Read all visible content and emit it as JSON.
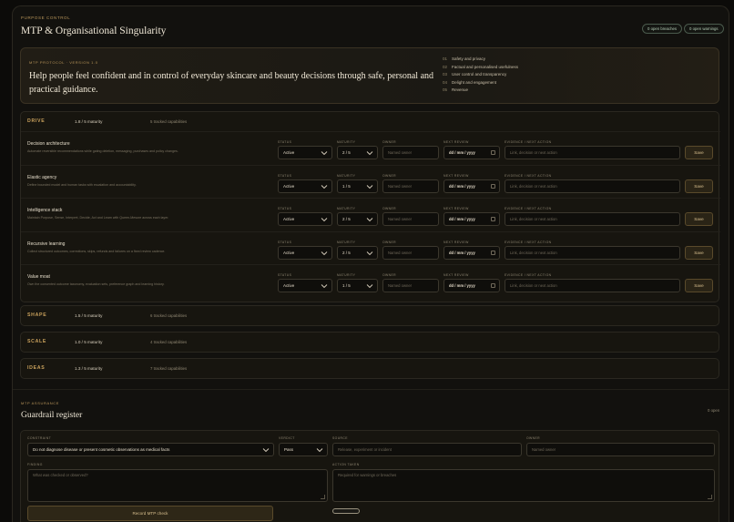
{
  "header": {
    "eyebrow": "PURPOSE CONTROL",
    "title": "MTP & Organisational Singularity",
    "breaches": "0 open breaches",
    "warnings": "0 open warnings"
  },
  "protocol": {
    "label": "MTP PROTOCOL · VERSION 1.0",
    "statement": "Help people feel confident and in control of everyday skincare and beauty decisions through safe, personal and practical guidance.",
    "principles": [
      {
        "n": "01",
        "label": "Safety and privacy"
      },
      {
        "n": "02",
        "label": "Factual and personalised usefulness"
      },
      {
        "n": "03",
        "label": "User control and transparency"
      },
      {
        "n": "04",
        "label": "Delight and engagement"
      },
      {
        "n": "05",
        "label": "Revenue"
      }
    ]
  },
  "labels": {
    "status": "STATUS",
    "maturity": "MATURITY",
    "owner": "OWNER",
    "next_review": "NEXT REVIEW",
    "evidence": "EVIDENCE / NEXT ACTION",
    "owner_ph": "Named owner",
    "date_ph": "dd / mm / yyyy",
    "evidence_ph": "Link, decision or next action",
    "save": "Save"
  },
  "sections": [
    {
      "name": "DRIVE",
      "maturity": "1.8 / 5 maturity",
      "count": "5 tracked capabilities",
      "capabilities": [
        {
          "name": "Decision architecture",
          "desc": "Automate reversible recommendations while gating deletion, messaging, purchases and policy changes.",
          "status": "Active",
          "maturity": "2 / 5"
        },
        {
          "name": "Elastic agency",
          "desc": "Define bounded model and human tasks with escalation and accountability.",
          "status": "Active",
          "maturity": "1 / 5"
        },
        {
          "name": "Intelligence stack",
          "desc": "Maintain Purpose, Sense, Interpret, Decide, Act and Learn with Queen-Mesure across each layer.",
          "status": "Active",
          "maturity": "2 / 5"
        },
        {
          "name": "Recursive learning",
          "desc": "Collect structured outcomes, corrections, skips, refunds and failures on a fixed review cadence.",
          "status": "Active",
          "maturity": "2 / 5"
        },
        {
          "name": "Value moat",
          "desc": "Own the consented outcome taxonomy, evaluation sets, preference graph and learning history.",
          "status": "Active",
          "maturity": "1 / 5"
        }
      ]
    },
    {
      "name": "SHAPE",
      "maturity": "1.5 / 5 maturity",
      "count": "6 tracked capabilities"
    },
    {
      "name": "SCALE",
      "maturity": "1.0 / 5 maturity",
      "count": "4 tracked capabilities"
    },
    {
      "name": "IDEAS",
      "maturity": "1.3 / 5 maturity",
      "count": "7 tracked capabilities"
    }
  ],
  "guardrail": {
    "eyebrow": "MTP ASSURANCE",
    "title": "Guardrail register",
    "open_count": "0 open",
    "constraint_label": "CONSTRAINT",
    "constraint_value": "Do not diagnose disease or present cosmetic observations as medical facts",
    "verdict_label": "VERDICT",
    "verdict_value": "Pass",
    "source_label": "SOURCE",
    "source_ph": "Release, experiment or incident",
    "owner_label": "OWNER",
    "owner_ph": "Named owner",
    "finding_label": "FINDING",
    "finding_ph": "What was checked or observed?",
    "action_label": "ACTION TAKEN",
    "action_ph": "Required for warnings or breaches",
    "record": "Record MTP check"
  },
  "colors": {
    "accent": "#c9a15c",
    "background": "#12110e",
    "success": "#b3cbb5"
  }
}
